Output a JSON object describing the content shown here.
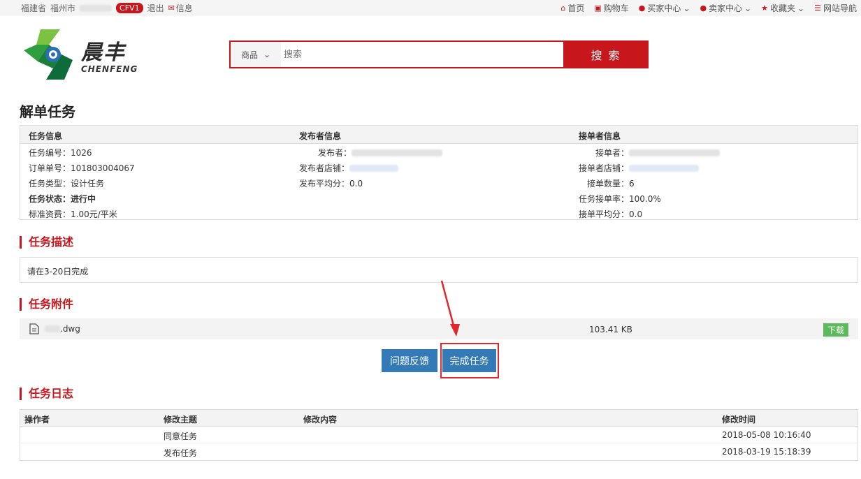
{
  "topbar": {
    "province": "福建省",
    "city": "福州市",
    "badge": "CFV1",
    "logout": "退出",
    "messages": "信息",
    "nav": [
      {
        "label": "首页",
        "icon": "home-icon"
      },
      {
        "label": "购物车",
        "icon": "cart-icon"
      },
      {
        "label": "买家中心",
        "icon": "user-icon"
      },
      {
        "label": "卖家中心",
        "icon": "user-icon"
      },
      {
        "label": "收藏夹",
        "icon": "star-icon"
      },
      {
        "label": "网站导航",
        "icon": "list-icon"
      }
    ]
  },
  "logo": {
    "cn": "晨丰",
    "en": "CHENFENG"
  },
  "search": {
    "category": "商品",
    "placeholder": "搜索",
    "button": "搜 索"
  },
  "page_title": "解单任务",
  "info": {
    "headers": [
      "任务信息",
      "发布者信息",
      "接单者信息"
    ],
    "task": {
      "id": "任务编号：1026",
      "order": "订单单号：101803004067",
      "type": "任务类型：设计任务",
      "status": "任务状态：进行中",
      "price": "标准资费：1.00元/平米"
    },
    "publisher": {
      "name_label": "发布者：",
      "shop_label": "发布者店铺：",
      "avg_score": "发布平均分：0.0"
    },
    "taker": {
      "name_label": "接单者：",
      "shop_label": "接单者店铺：",
      "count": "接单数量：6",
      "rate": "任务接单率：100.0%",
      "avg_score": "接单平均分：0.0"
    }
  },
  "sections": {
    "description": "任务描述",
    "attachments": "任务附件",
    "log": "任务日志"
  },
  "description_text": "请在3-20日完成",
  "attachment": {
    "filename": ".dwg",
    "size": "103.41 KB",
    "download": "下载"
  },
  "buttons": {
    "feedback": "问题反馈",
    "complete": "完成任务"
  },
  "log": {
    "headers": [
      "操作者",
      "修改主题",
      "修改内容",
      "修改时间"
    ],
    "rows": [
      {
        "topic": "同意任务",
        "content": "",
        "time": "2018-05-08 10:16:40"
      },
      {
        "topic": "发布任务",
        "content": "",
        "time": "2018-03-19 15:18:39"
      }
    ]
  },
  "colors": {
    "brand_red": "#c8161d",
    "button_blue": "#337ab7",
    "download_green": "#5cb85c"
  }
}
